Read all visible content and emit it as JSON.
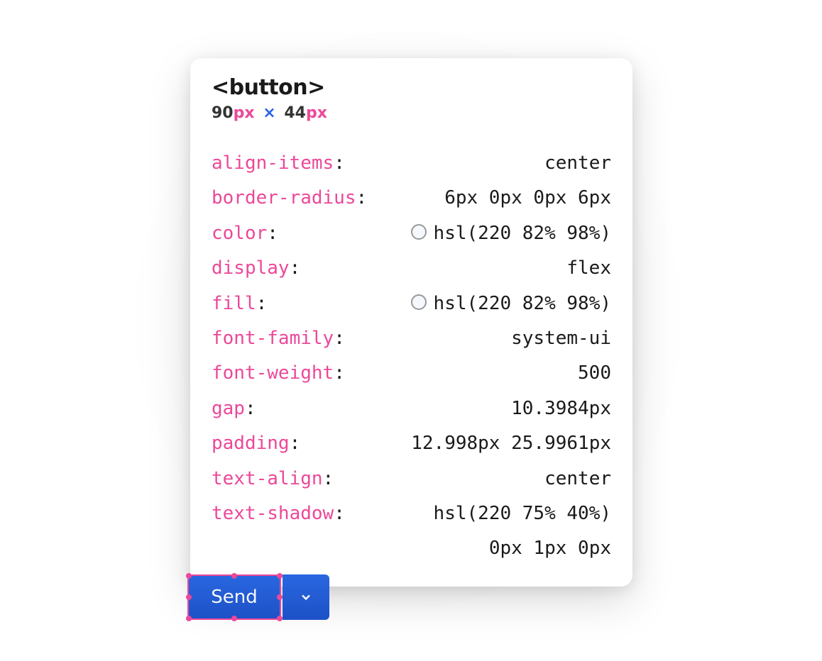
{
  "tooltip": {
    "element_tag": "<button>",
    "dimensions": {
      "width": "90",
      "width_unit": "px",
      "separator": "×",
      "height": "44",
      "height_unit": "px"
    },
    "properties": [
      {
        "name": "align-items",
        "value": "center",
        "swatch": false
      },
      {
        "name": "border-radius",
        "value": "6px 0px 0px 6px",
        "swatch": false
      },
      {
        "name": "color",
        "value": "hsl(220 82% 98%)",
        "swatch": true
      },
      {
        "name": "display",
        "value": "flex",
        "swatch": false
      },
      {
        "name": "fill",
        "value": "hsl(220 82% 98%)",
        "swatch": true
      },
      {
        "name": "font-family",
        "value": "system-ui",
        "swatch": false
      },
      {
        "name": "font-weight",
        "value": "500",
        "swatch": false
      },
      {
        "name": "gap",
        "value": "10.3984px",
        "swatch": false
      },
      {
        "name": "padding",
        "value": "12.998px 25.9961px",
        "swatch": false
      },
      {
        "name": "text-align",
        "value": "center",
        "swatch": false
      },
      {
        "name": "text-shadow",
        "value": "hsl(220 75% 40%)\n0px 1px 0px",
        "swatch": false
      }
    ]
  },
  "buttons": {
    "send_label": "Send"
  }
}
